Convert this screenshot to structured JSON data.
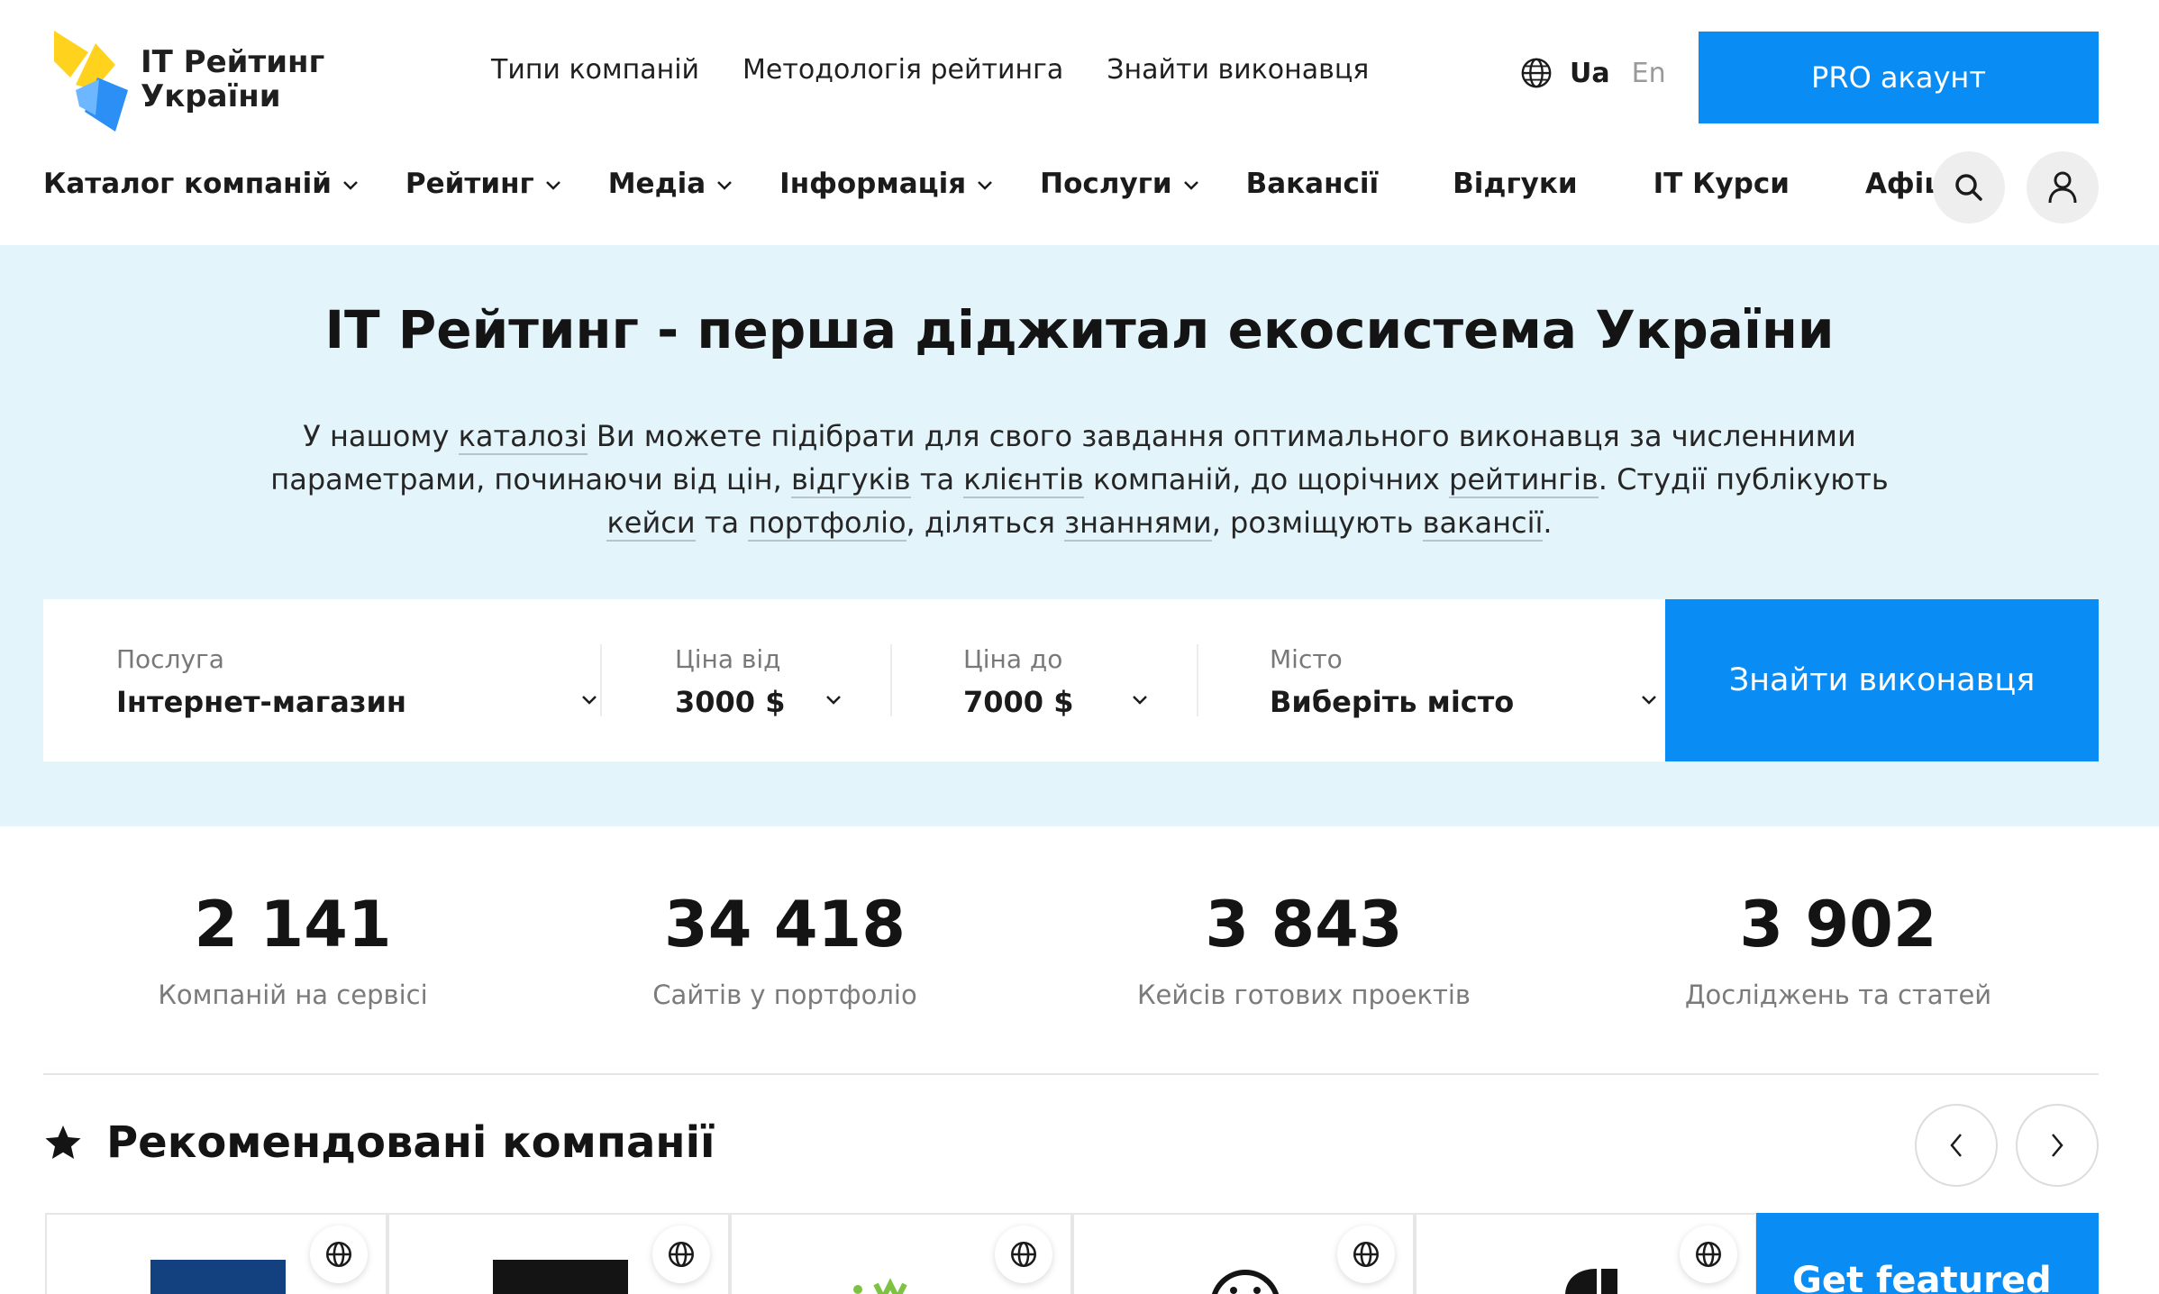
{
  "brand": {
    "line1": "IT Рейтинг",
    "line2": "України",
    "colors": {
      "yellow": "#ffd21e",
      "blue": "#2b8ff5",
      "accent": "#0a8cf5",
      "hero_bg": "#e3f4fb"
    }
  },
  "top_nav": {
    "items": [
      "Типи компаній",
      "Методологія рейтинга",
      "Знайти виконавця"
    ]
  },
  "lang": {
    "icon": "globe-icon",
    "current": "Ua",
    "other": "En"
  },
  "pro_button": "PRO акаунт",
  "main_nav": {
    "items": [
      {
        "label": "Каталог компаній",
        "dropdown": true
      },
      {
        "label": "Рейтинг",
        "dropdown": true
      },
      {
        "label": "Медіа",
        "dropdown": true
      },
      {
        "label": "Інформація",
        "dropdown": true
      },
      {
        "label": "Послуги",
        "dropdown": true
      },
      {
        "label": "Вакансії",
        "dropdown": false
      },
      {
        "label": "Відгуки",
        "dropdown": false
      },
      {
        "label": "IT Курси",
        "dropdown": false
      },
      {
        "label": "Афіша",
        "dropdown": false
      }
    ],
    "search_icon": "search-icon",
    "user_icon": "user-icon"
  },
  "hero": {
    "title": "IT Рейтинг - перша діджитал екосистема України",
    "desc": {
      "p1": "У нашому ",
      "l1": "каталозі",
      "p2": " Ви можете підібрати для свого завдання оптимального виконавця за численними параметрами, починаючи від цін, ",
      "l2": "відгуків",
      "p3": " та ",
      "l3": "клієнтів",
      "p4": " компаній, до щорічних ",
      "l4": "рейтингів",
      "p5": ". Студії публікують ",
      "l5": "кейси",
      "p6": " та ",
      "l6": "портфоліо",
      "p7": ", діляться ",
      "l7": "знаннями",
      "p8": ", розміщують ",
      "l8": "вакансії",
      "p9": "."
    }
  },
  "search": {
    "service": {
      "label": "Послуга",
      "value": "Інтернет-магазин"
    },
    "price_from": {
      "label": "Ціна від",
      "value": "3000 $"
    },
    "price_to": {
      "label": "Ціна до",
      "value": "7000 $"
    },
    "city": {
      "label": "Місто",
      "value": "Виберіть місто"
    },
    "submit": "Знайти виконавця"
  },
  "stats": [
    {
      "num": "2 141",
      "caption": "Компаній на сервісі"
    },
    {
      "num": "34 418",
      "caption": "Сайтів у портфоліо"
    },
    {
      "num": "3 843",
      "caption": "Кейсів готових проектів"
    },
    {
      "num": "3 902",
      "caption": "Досліджень та статей"
    }
  ],
  "recommended": {
    "title": "Рекомендовані компанії",
    "star_icon": "star-icon",
    "prev_icon": "chevron-left-icon",
    "next_icon": "chevron-right-icon",
    "featured_cta": "Get featured"
  }
}
